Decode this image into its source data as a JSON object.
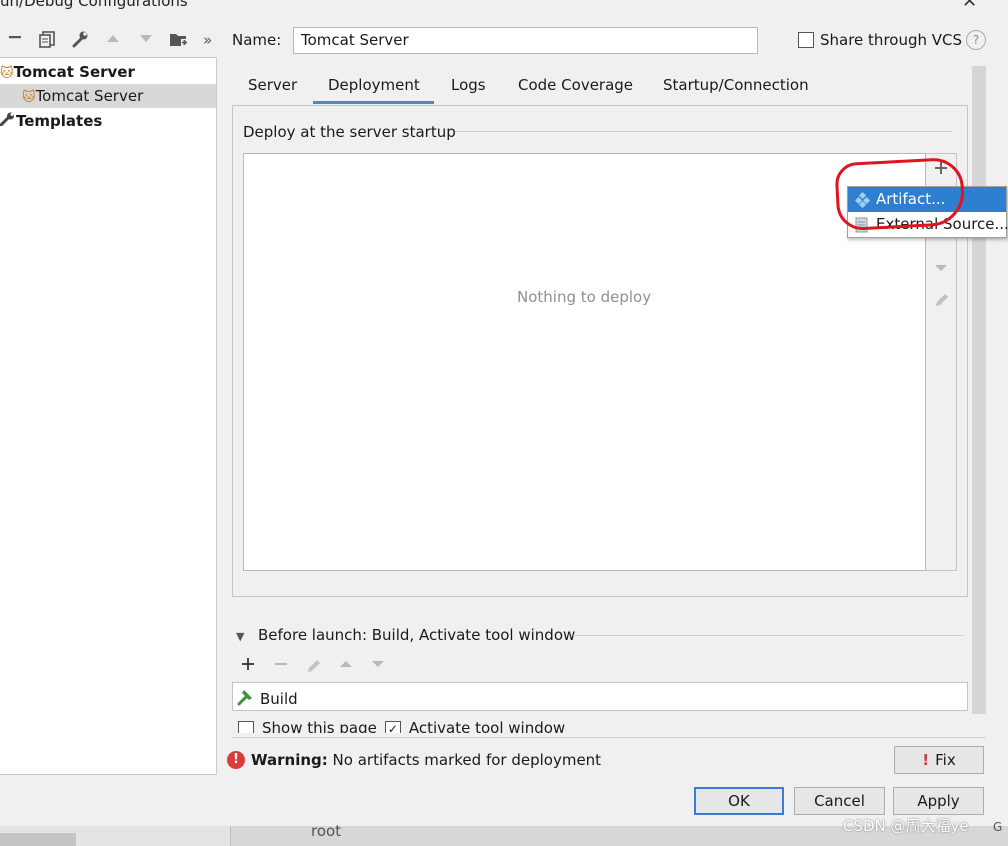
{
  "window": {
    "title": "un/Debug Configurations",
    "close_glyph": "✕"
  },
  "toolbar": {
    "icons": [
      "minus-icon",
      "copy-icon",
      "wrench-icon",
      "arrow-up-icon",
      "arrow-down-icon",
      "folder-add-icon",
      "more-icon"
    ],
    "more_glyph": "»"
  },
  "tree": {
    "items": [
      {
        "label": "Tomcat Server",
        "icon": "tomcat-icon",
        "bold": true
      },
      {
        "label": "Tomcat Server",
        "icon": "tomcat-error-icon",
        "bold": false,
        "selected": true
      },
      {
        "label": "Templates",
        "icon": "wrench-icon",
        "bold": true
      }
    ]
  },
  "config": {
    "name_label": "Name:",
    "name_value": "Tomcat Server",
    "share_label": "Share through VCS",
    "share_checked": false,
    "help_glyph": "?"
  },
  "tabs": [
    {
      "label": "Server",
      "active": false
    },
    {
      "label": "Deployment",
      "active": true
    },
    {
      "label": "Logs",
      "active": false
    },
    {
      "label": "Code Coverage",
      "active": false
    },
    {
      "label": "Startup/Connection",
      "active": false
    }
  ],
  "deployment": {
    "section_label": "Deploy at the server startup",
    "empty_text": "Nothing to deploy",
    "side_tools": [
      "add-icon",
      "remove-icon",
      "move-down-icon",
      "edit-icon"
    ]
  },
  "popup_menu": {
    "items": [
      {
        "label": "Artifact...",
        "icon": "artifact-icon",
        "highlighted": true
      },
      {
        "label": "External Source...",
        "icon": "external-source-icon",
        "highlighted": false
      }
    ]
  },
  "before_launch": {
    "label": "Before launch: Build, Activate tool window",
    "tools": [
      "add-icon",
      "remove-icon",
      "edit-icon",
      "move-up-icon",
      "move-down-icon"
    ],
    "tasks": [
      {
        "label": "Build",
        "icon": "hammer-icon"
      }
    ],
    "show_page_label": "Show this page",
    "activate_label": "Activate tool window",
    "activate_checked": true
  },
  "warning": {
    "title": "Warning:",
    "text": "No artifacts marked for deployment",
    "fix_label": "Fix"
  },
  "buttons": {
    "ok": "OK",
    "cancel": "Cancel",
    "apply": "Apply"
  },
  "background": {
    "root_text": "root",
    "watermark": "CSDN @周大福ye",
    "edge_text": "G"
  },
  "colors": {
    "accent": "#4a88c7",
    "selection": "#2f7fd0",
    "annotation": "#e0141e",
    "warning": "#db3b3b"
  }
}
